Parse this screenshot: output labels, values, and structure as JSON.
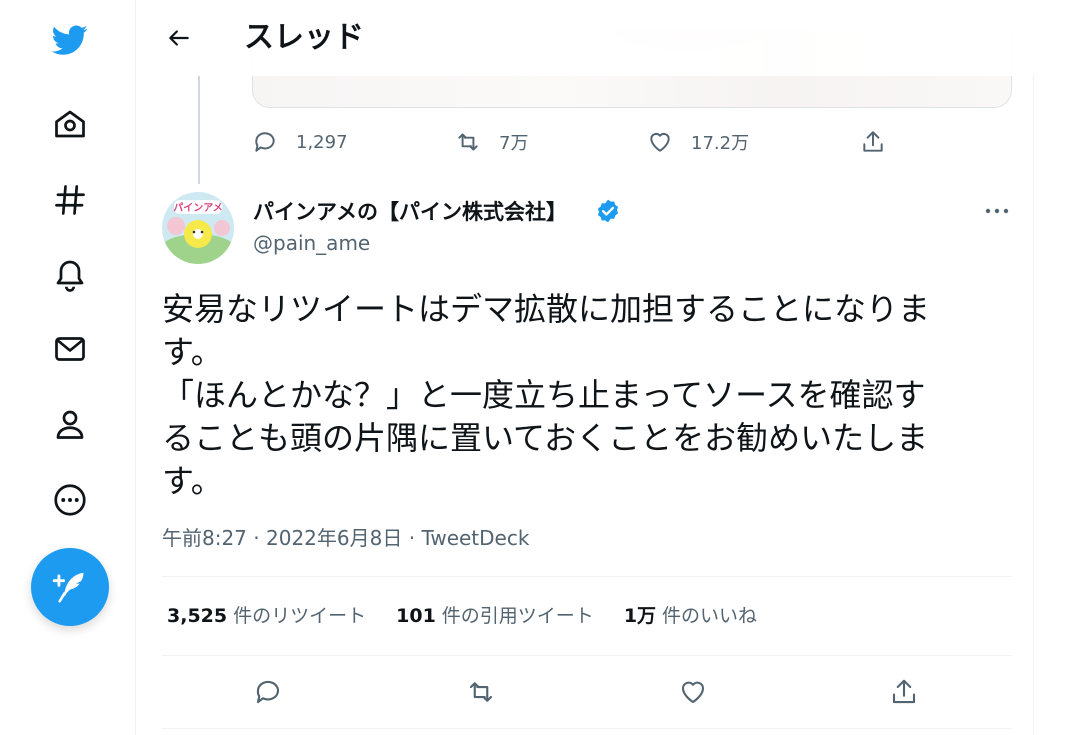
{
  "header": {
    "title": "スレッド"
  },
  "nav": {
    "items": [
      "twitter-logo",
      "home",
      "explore",
      "notifications",
      "messages",
      "profile",
      "more"
    ]
  },
  "prev_tweet": {
    "reply_count": "1,297",
    "retweet_count": "7万",
    "like_count": "17.2万"
  },
  "tweet": {
    "author_name": "パインアメの【パイン株式会社】",
    "handle": "@pain_ame",
    "text": "安易なリツイートはデマ拡散に加担することになりま\nす。\n「ほんとかな？」と一度立ち止まってソースを確認す\nることも頭の片隅に置いておくことをお勧めいたしま\nす。",
    "time": "午前8:27",
    "date": "2022年6月8日",
    "source": "TweetDeck",
    "separator": " · "
  },
  "stats": {
    "retweets_value": "3,525",
    "retweets_label": "件のリツイート",
    "quotes_value": "101",
    "quotes_label": "件の引用ツイート",
    "likes_value": "1万",
    "likes_label": "件のいいね"
  },
  "colors": {
    "brand": "#1d9bf0",
    "text_primary": "#0f1419",
    "text_secondary": "#536471",
    "divider": "#eff3f4"
  }
}
